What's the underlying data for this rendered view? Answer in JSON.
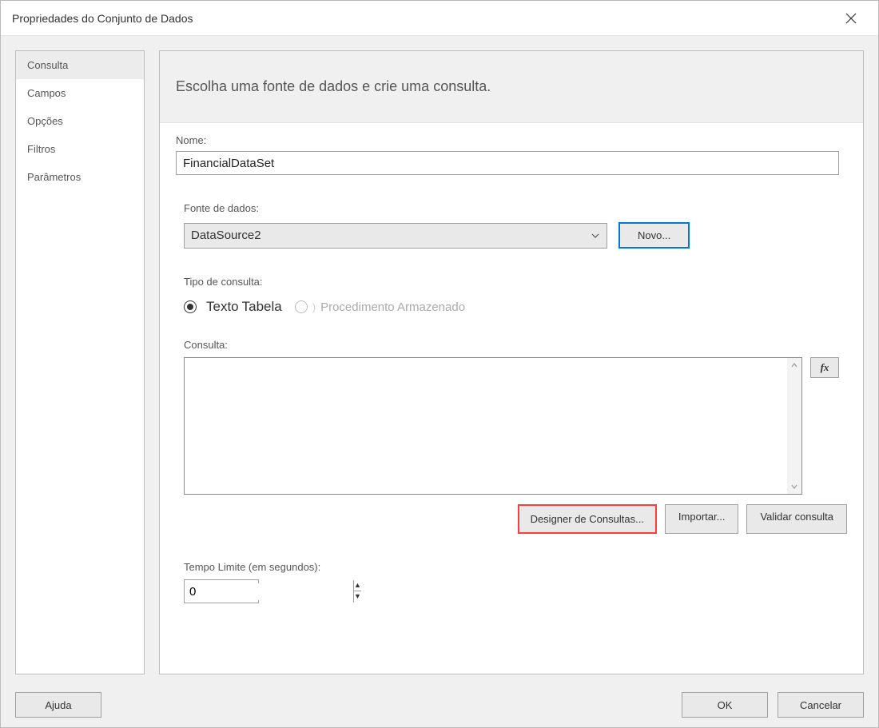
{
  "title": "Propriedades do Conjunto de Dados",
  "sidebar": {
    "items": [
      {
        "label": "Consulta",
        "active": true
      },
      {
        "label": "Campos"
      },
      {
        "label": "Opções"
      },
      {
        "label": "Filtros"
      },
      {
        "label": "Parâmetros"
      }
    ]
  },
  "main": {
    "headline": "Escolha uma fonte de dados e crie uma consulta.",
    "name_label": "Nome:",
    "name_value": "FinancialDataSet",
    "datasource_label": "Fonte de dados:",
    "datasource_value": "DataSource2",
    "novo_label": "Novo...",
    "querytype_label": "Tipo de consulta:",
    "radio_text": "Texto",
    "radio_table": "Tabela",
    "radio_sp": "Procedimento Armazenado",
    "query_label": "Consulta:",
    "query_value": "",
    "fx_label": "fx",
    "designer_label": "Designer de Consultas...",
    "import_label": "Importar...",
    "validate_label": "Validar consulta",
    "timeout_label": "Tempo Limite (em segundos):",
    "timeout_value": "0"
  },
  "footer": {
    "help": "Ajuda",
    "ok": "OK",
    "cancel": "Cancelar"
  }
}
